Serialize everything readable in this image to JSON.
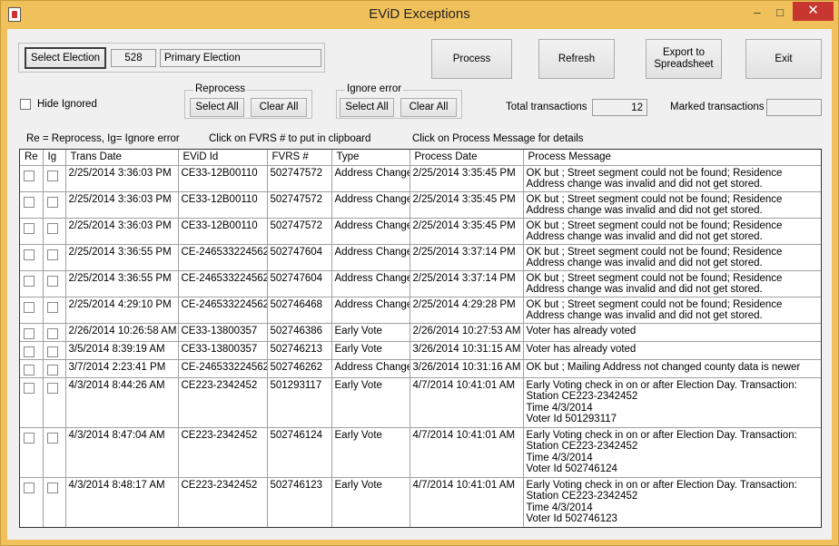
{
  "window": {
    "title": "EViD Exceptions",
    "minimize": "‒",
    "maximize": "□",
    "close": "✕"
  },
  "election": {
    "select_label": "Select Election",
    "id": "528",
    "name": "Primary Election"
  },
  "actions": {
    "process": "Process",
    "refresh": "Refresh",
    "export_line1": "Export to",
    "export_line2": "Spreadsheet",
    "exit": "Exit"
  },
  "hide_ignored": {
    "label": "Hide Ignored"
  },
  "reprocess": {
    "title": "Reprocess",
    "select_all": "Select All",
    "clear_all": "Clear All"
  },
  "ignore_error": {
    "title": "Ignore error",
    "select_all": "Select All",
    "clear_all": "Clear All"
  },
  "totals": {
    "total_label": "Total transactions",
    "total_value": "12",
    "marked_label": "Marked transactions",
    "marked_value": ""
  },
  "hints": {
    "legend": "Re = Reprocess, Ig= Ignore error",
    "clipboard": "Click on FVRS # to put in clipboard",
    "details": "Click on Process Message for details"
  },
  "table": {
    "columns": [
      "Re",
      "Ig",
      "Trans Date",
      "EViD Id",
      "FVRS #",
      "Type",
      "Process Date",
      "Process Message"
    ],
    "rows": [
      {
        "trans_date": "2/25/2014 3:36:03 PM",
        "evid": "CE33-12B00110",
        "fvrs": "502747572",
        "type": "Address Change",
        "process_date": "2/25/2014 3:35:45 PM",
        "message": "OK but ; Street segment could not be found; Residence Address change was invalid and did not get stored."
      },
      {
        "trans_date": "2/25/2014 3:36:03 PM",
        "evid": "CE33-12B00110",
        "fvrs": "502747572",
        "type": "Address Change",
        "process_date": "2/25/2014 3:35:45 PM",
        "message": "OK but ; Street segment could not be found; Residence Address change was invalid and did not get stored."
      },
      {
        "trans_date": "2/25/2014 3:36:03 PM",
        "evid": "CE33-12B00110",
        "fvrs": "502747572",
        "type": "Address Change",
        "process_date": "2/25/2014 3:35:45 PM",
        "message": "OK but ; Street segment could not be found; Residence Address change was invalid and did not get stored."
      },
      {
        "trans_date": "2/25/2014 3:36:55 PM",
        "evid": "CE-246533224562",
        "fvrs": "502747604",
        "type": "Address Change",
        "process_date": "2/25/2014 3:37:14 PM",
        "message": "OK but ; Street segment could not be found; Residence Address change was invalid and did not get stored."
      },
      {
        "trans_date": "2/25/2014 3:36:55 PM",
        "evid": "CE-246533224562",
        "fvrs": "502747604",
        "type": "Address Change",
        "process_date": "2/25/2014 3:37:14 PM",
        "message": "OK but ; Street segment could not be found; Residence Address change was invalid and did not get stored."
      },
      {
        "trans_date": "2/25/2014 4:29:10 PM",
        "evid": "CE-246533224562",
        "fvrs": "502746468",
        "type": "Address Change",
        "process_date": "2/25/2014 4:29:28 PM",
        "message": "OK but ; Street segment could not be found; Residence Address change was invalid and did not get stored."
      },
      {
        "trans_date": "2/26/2014 10:26:58 AM",
        "evid": "CE33-13800357",
        "fvrs": "502746386",
        "type": "Early Vote",
        "process_date": "2/26/2014 10:27:53 AM",
        "message": "Voter has already voted"
      },
      {
        "trans_date": "3/5/2014 8:39:19 AM",
        "evid": "CE33-13800357",
        "fvrs": "502746213",
        "type": "Early Vote",
        "process_date": "3/26/2014 10:31:15 AM",
        "message": "Voter has already voted"
      },
      {
        "trans_date": "3/7/2014 2:23:41 PM",
        "evid": "CE-246533224562",
        "fvrs": "502746262",
        "type": "Address Change",
        "process_date": "3/26/2014 10:31:16 AM",
        "message": "OK but ; Mailing Address not changed county data is newer"
      },
      {
        "trans_date": "4/3/2014 8:44:26 AM",
        "evid": "CE223-2342452",
        "fvrs": "501293117",
        "type": "Early Vote",
        "process_date": "4/7/2014 10:41:01 AM",
        "message": "Early Voting check in on or after Election Day. Transaction:\nStation CE223-2342452\nTime 4/3/2014\nVoter Id 501293117"
      },
      {
        "trans_date": "4/3/2014 8:47:04 AM",
        "evid": "CE223-2342452",
        "fvrs": "502746124",
        "type": "Early Vote",
        "process_date": "4/7/2014 10:41:01 AM",
        "message": "Early Voting check in on or after Election Day. Transaction:\nStation CE223-2342452\nTime 4/3/2014\nVoter Id 502746124"
      },
      {
        "trans_date": "4/3/2014 8:48:17 AM",
        "evid": "CE223-2342452",
        "fvrs": "502746123",
        "type": "Early Vote",
        "process_date": "4/7/2014 10:41:01 AM",
        "message": "Early Voting check in on or after Election Day. Transaction:\nStation CE223-2342452\nTime 4/3/2014\nVoter Id 502746123"
      }
    ]
  }
}
